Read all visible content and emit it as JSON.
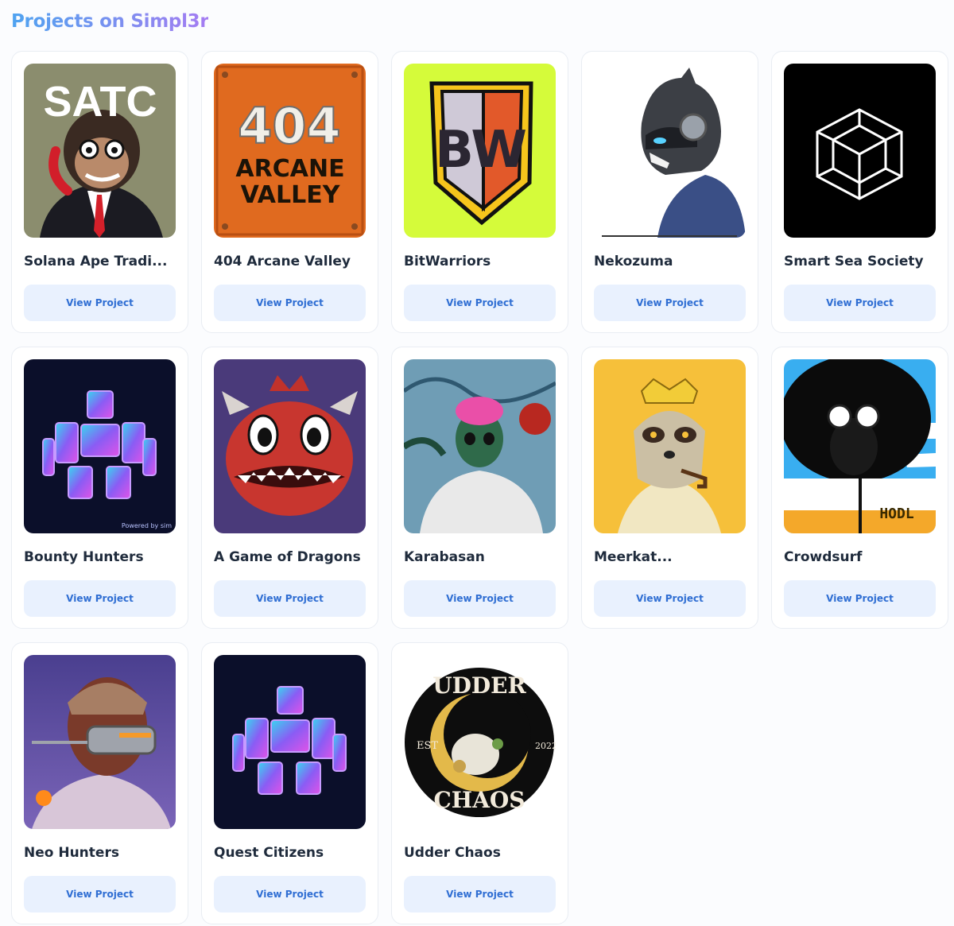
{
  "header": {
    "title": "Projects on Simpl3r"
  },
  "projects": [
    {
      "name": "Solana Ape Tradi...",
      "button": "View Project",
      "logo_text": "SATC",
      "image": "ape-avatar"
    },
    {
      "name": "404 Arcane Valley",
      "button": "View Project",
      "logo_text": [
        "404",
        "ARCANE",
        "VALLEY"
      ],
      "image": "arcane-logo"
    },
    {
      "name": "BitWarriors",
      "button": "View Project",
      "logo_text": "BW",
      "image": "shield-logo"
    },
    {
      "name": "Nekozuma",
      "button": "View Project",
      "image": "cat-warrior"
    },
    {
      "name": "Smart Sea Society",
      "button": "View Project",
      "image": "cube-logo"
    },
    {
      "name": "Bounty Hunters",
      "button": "View Project",
      "image": "neon-glyph",
      "footer_text": "Powered by sim"
    },
    {
      "name": "A Game of Dragons",
      "button": "View Project",
      "image": "dragon-face"
    },
    {
      "name": "Karabasan",
      "button": "View Project",
      "image": "skull-hoodie"
    },
    {
      "name": "Meerkat...",
      "button": "View Project",
      "image": "meerkat-king"
    },
    {
      "name": "Crowdsurf",
      "button": "View Project",
      "logo_text": "HODL",
      "image": "afro-character"
    },
    {
      "name": "Neo Hunters",
      "button": "View Project",
      "image": "masked-hunter"
    },
    {
      "name": "Quest Citizens",
      "button": "View Project",
      "image": "neon-glyph"
    },
    {
      "name": "Udder Chaos",
      "button": "View Project",
      "logo_text": [
        "UDDER",
        "CHAOS",
        "EST",
        "2022"
      ],
      "image": "cow-badge"
    }
  ],
  "colors": {
    "accent": "#2f6ed3",
    "button_bg": "#e9f1fe",
    "title_gradient": [
      "#4fa3f0",
      "#a57cf2"
    ]
  }
}
